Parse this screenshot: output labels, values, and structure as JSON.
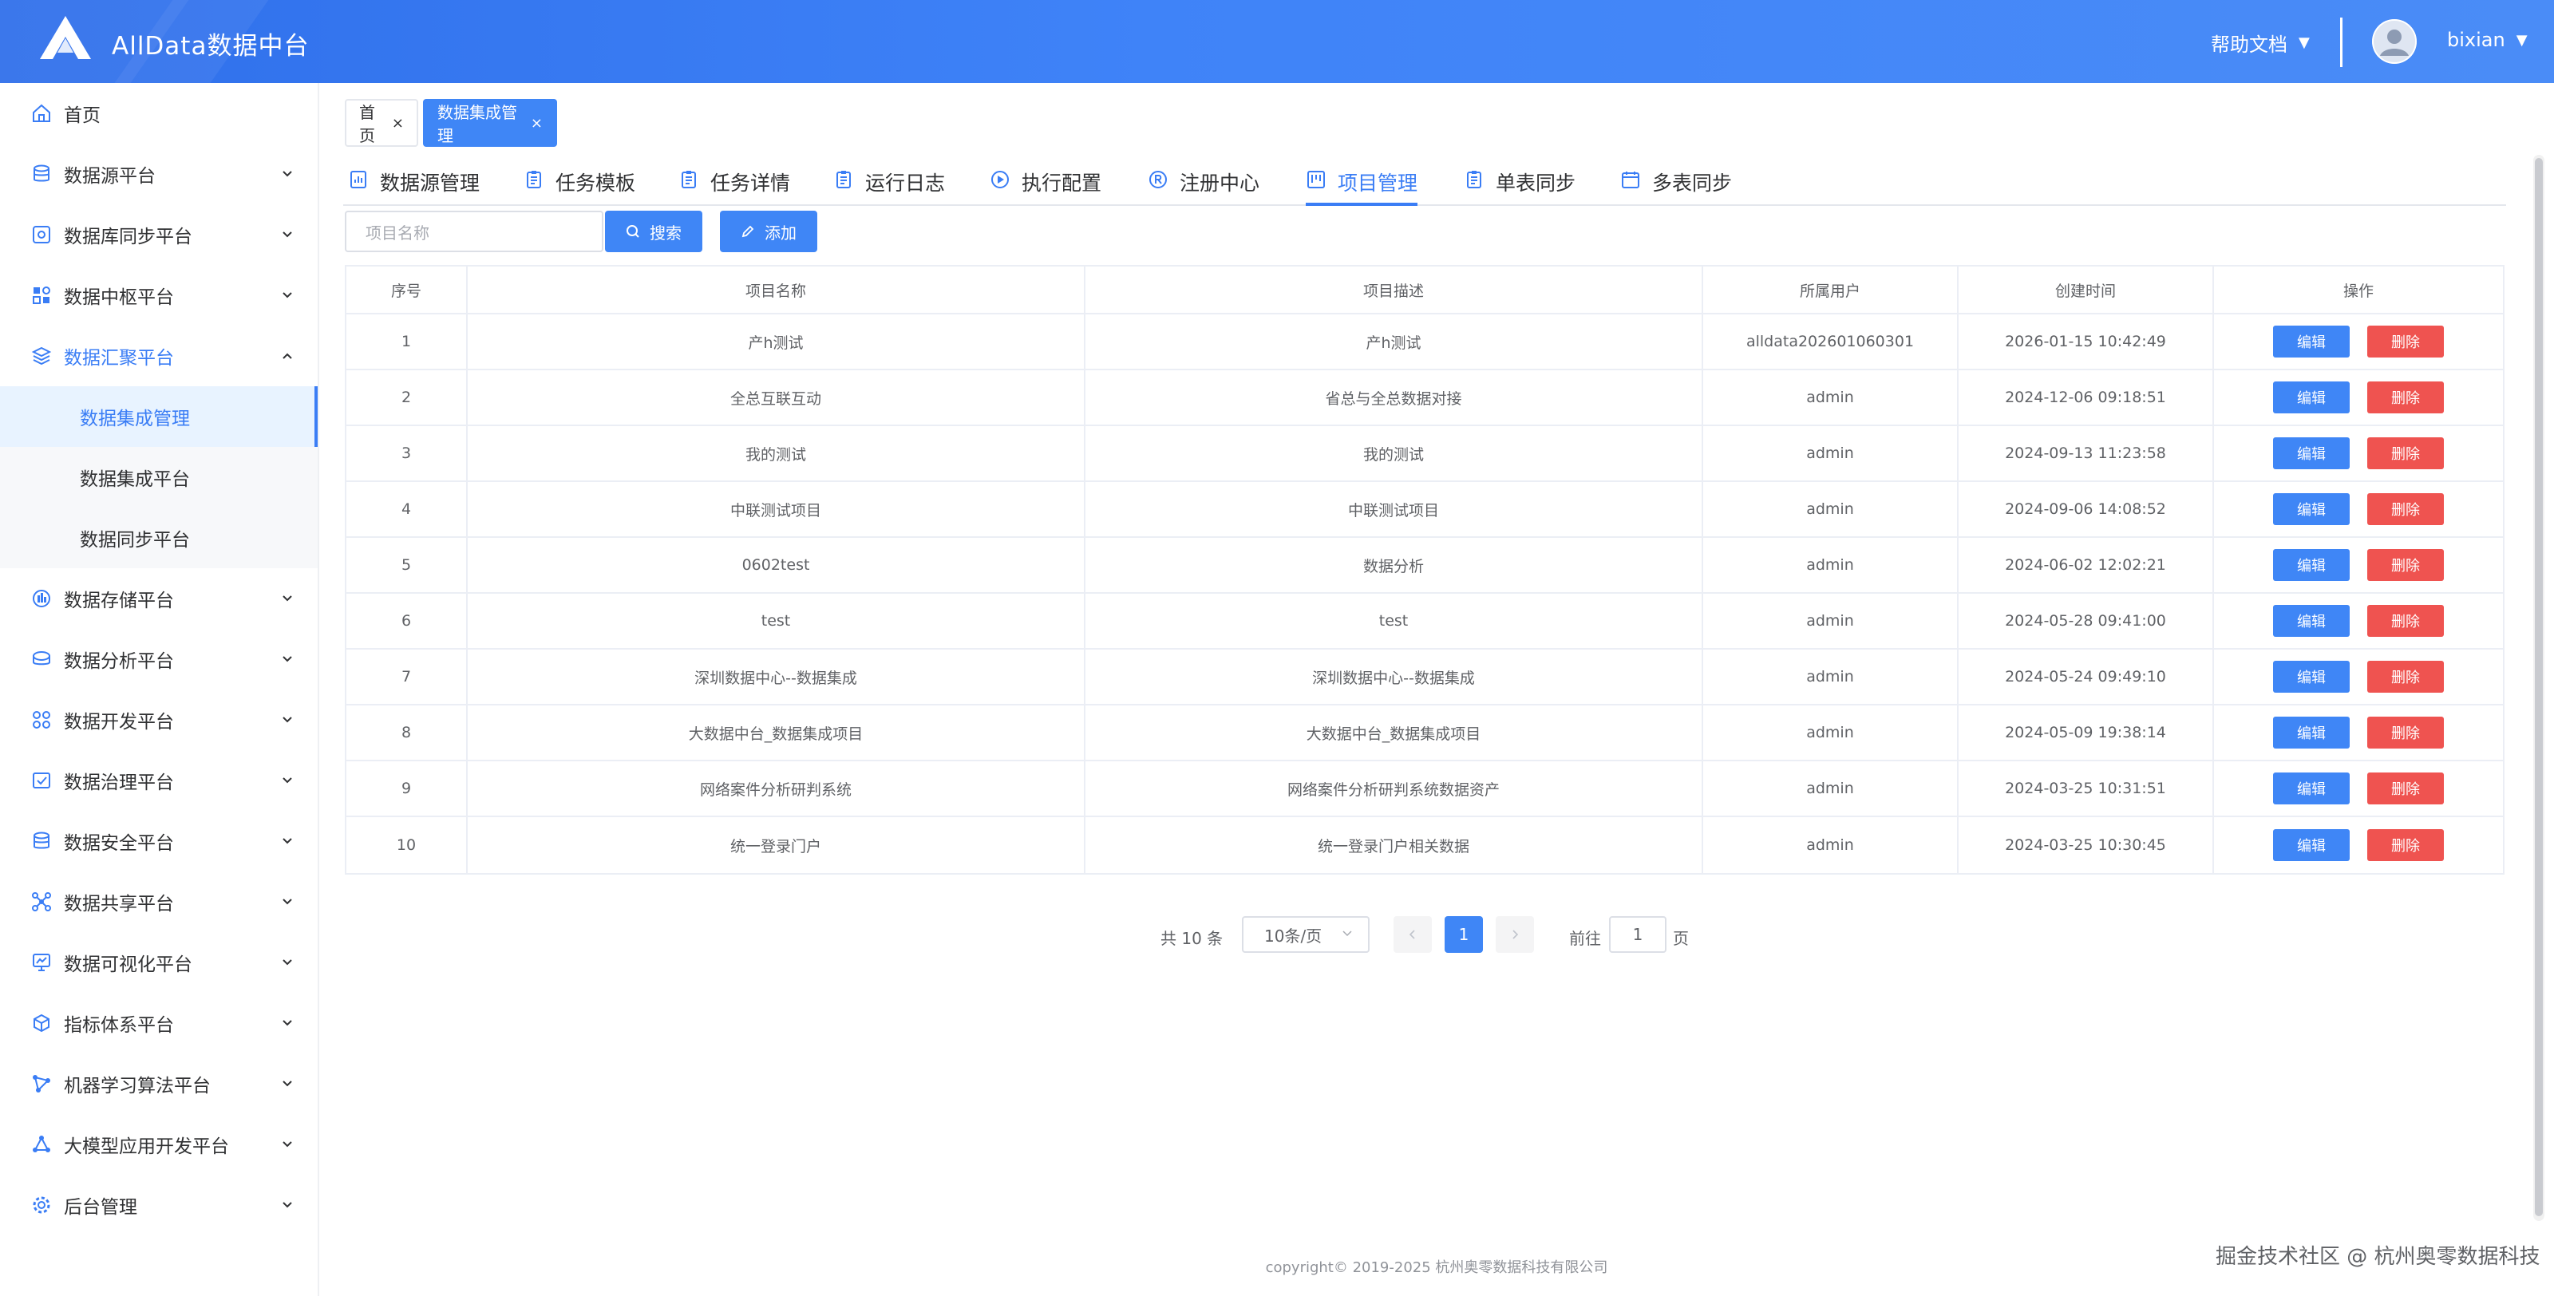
{
  "header": {
    "app_title": "AllData数据中台",
    "help_label": "帮助文档",
    "username": "bixian",
    "caret": "▼"
  },
  "sidebar": {
    "items": [
      {
        "label": "首页",
        "icon": "home-icon"
      },
      {
        "label": "数据源平台",
        "icon": "database-icon"
      },
      {
        "label": "数据库同步平台",
        "icon": "sync-icon"
      },
      {
        "label": "数据中枢平台",
        "icon": "grid-icon"
      },
      {
        "label": "数据汇聚平台",
        "icon": "layers-icon"
      },
      {
        "label": "数据存储平台",
        "icon": "storage-icon"
      },
      {
        "label": "数据分析平台",
        "icon": "analysis-icon"
      },
      {
        "label": "数据开发平台",
        "icon": "dev-icon"
      },
      {
        "label": "数据治理平台",
        "icon": "governance-icon"
      },
      {
        "label": "数据安全平台",
        "icon": "security-icon"
      },
      {
        "label": "数据共享平台",
        "icon": "share-icon"
      },
      {
        "label": "数据可视化平台",
        "icon": "monitor-icon"
      },
      {
        "label": "指标体系平台",
        "icon": "cube-icon"
      },
      {
        "label": "机器学习算法平台",
        "icon": "ml-icon"
      },
      {
        "label": "大模型应用开发平台",
        "icon": "llm-icon"
      },
      {
        "label": "后台管理",
        "icon": "settings-icon"
      }
    ],
    "sub_items": [
      {
        "label": "数据集成管理"
      },
      {
        "label": "数据集成平台"
      },
      {
        "label": "数据同步平台"
      }
    ]
  },
  "tags": {
    "home": "首页",
    "current": "数据集成管理",
    "close": "×"
  },
  "tabs": [
    {
      "label": "数据源管理"
    },
    {
      "label": "任务模板"
    },
    {
      "label": "任务详情"
    },
    {
      "label": "运行日志"
    },
    {
      "label": "执行配置"
    },
    {
      "label": "注册中心"
    },
    {
      "label": "项目管理"
    },
    {
      "label": "单表同步"
    },
    {
      "label": "多表同步"
    }
  ],
  "toolbar": {
    "search_placeholder": "项目名称",
    "search_label": "搜索",
    "add_label": "添加"
  },
  "table": {
    "columns": [
      "序号",
      "项目名称",
      "项目描述",
      "所属用户",
      "创建时间",
      "操作"
    ],
    "edit_label": "编辑",
    "delete_label": "删除",
    "rows": [
      [
        "1",
        "产h测试",
        "产h测试",
        "alldata202601060301",
        "2026-01-15 10:42:49"
      ],
      [
        "2",
        "全总互联互动",
        "省总与全总数据对接",
        "admin",
        "2024-12-06 09:18:51"
      ],
      [
        "3",
        "我的测试",
        "我的测试",
        "admin",
        "2024-09-13 11:23:58"
      ],
      [
        "4",
        "中联测试项目",
        "中联测试项目",
        "admin",
        "2024-09-06 14:08:52"
      ],
      [
        "5",
        "0602test",
        "数据分析",
        "admin",
        "2024-06-02 12:02:21"
      ],
      [
        "6",
        "test",
        "test",
        "admin",
        "2024-05-28 09:41:00"
      ],
      [
        "7",
        "深圳数据中心--数据集成",
        "深圳数据中心--数据集成",
        "admin",
        "2024-05-24 09:49:10"
      ],
      [
        "8",
        "大数据中台_数据集成项目",
        "大数据中台_数据集成项目",
        "admin",
        "2024-05-09 19:38:14"
      ],
      [
        "9",
        "网络案件分析研判系统",
        "网络案件分析研判系统数据资产",
        "admin",
        "2024-03-25 10:31:51"
      ],
      [
        "10",
        "统一登录门户",
        "统一登录门户相关数据",
        "admin",
        "2024-03-25 10:30:45"
      ]
    ]
  },
  "pagination": {
    "total": "共 10 条",
    "page_size": "10条/页",
    "current_page": "1",
    "goto_label": "前往",
    "goto_value": "1",
    "page_suffix": "页"
  },
  "footer": {
    "copyright": "copyright© 2019-2025 杭州奥零数据科技有限公司",
    "watermark": "掘金技术社区 @ 杭州奥零数据科技"
  },
  "colors": {
    "primary": "#3f86f6",
    "danger": "#ef5350",
    "header_start": "#2f6fea",
    "header_end": "#4a8cf7"
  }
}
